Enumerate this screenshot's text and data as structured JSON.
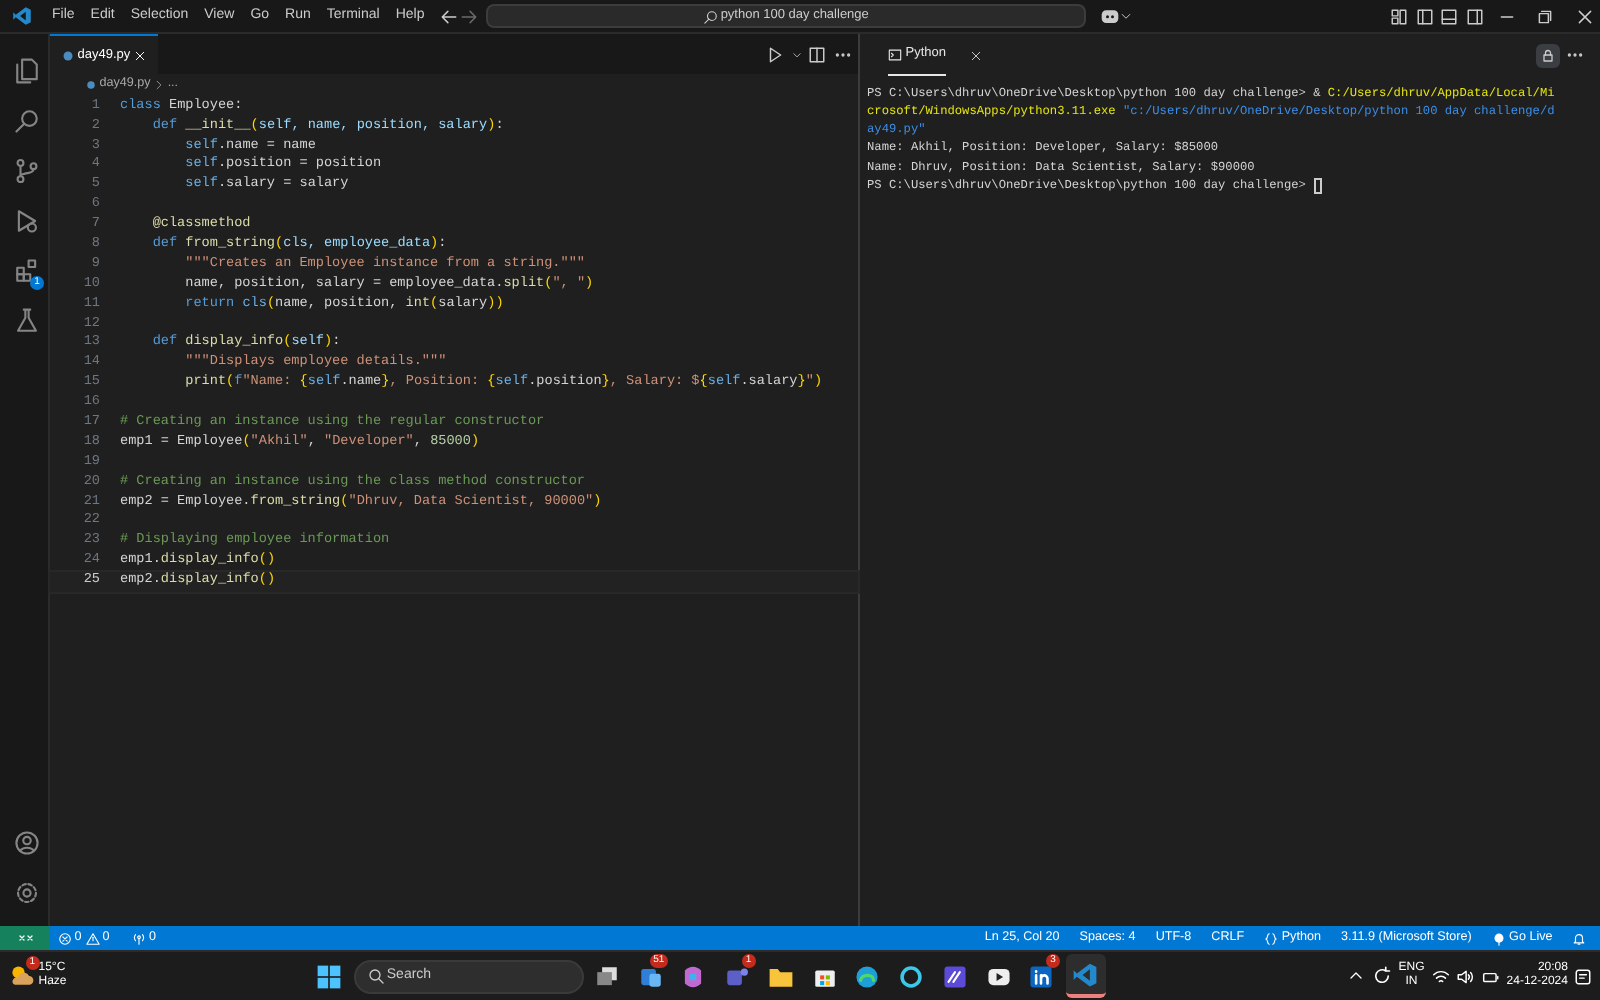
{
  "title_bar": {
    "menu": [
      "File",
      "Edit",
      "Selection",
      "View",
      "Go",
      "Run",
      "Terminal",
      "Help"
    ],
    "command_center": "python 100 day challenge"
  },
  "activity_bar": {
    "items": [
      {
        "kind": "explorer",
        "selected": false
      },
      {
        "kind": "search",
        "selected": false
      },
      {
        "kind": "source-control",
        "selected": false
      },
      {
        "kind": "run",
        "selected": false
      },
      {
        "kind": "extensions",
        "selected": false,
        "badge": "1"
      },
      {
        "kind": "testing",
        "selected": false
      }
    ],
    "bottom": [
      {
        "kind": "account"
      },
      {
        "kind": "settings"
      }
    ]
  },
  "editor": {
    "tabs": [
      {
        "label": "day49.py",
        "selected": true
      }
    ],
    "breadcrumb": [
      "day49.py",
      "..."
    ],
    "lines": [
      {
        "number": "1",
        "current": false,
        "tokens": [
          {
            "kind": "keyword",
            "text": "class"
          },
          {
            "kind": "plain",
            "text": " Employee:"
          }
        ]
      },
      {
        "number": "2",
        "current": false,
        "tokens": [
          {
            "kind": "keyword",
            "text": "    def"
          },
          {
            "kind": "function",
            "text": " __init__"
          },
          {
            "kind": "bracket",
            "text": "("
          },
          {
            "kind": "param",
            "text": "self, name, position, salary"
          },
          {
            "kind": "bracket",
            "text": ")"
          },
          {
            "kind": "plain",
            "text": ":"
          }
        ]
      },
      {
        "number": "3",
        "current": false,
        "tokens": [
          {
            "kind": "self",
            "text": "        self"
          },
          {
            "kind": "plain",
            "text": ".name = name"
          }
        ]
      },
      {
        "number": "4",
        "current": false,
        "tokens": [
          {
            "kind": "self",
            "text": "        self"
          },
          {
            "kind": "plain",
            "text": ".position = position"
          }
        ]
      },
      {
        "number": "5",
        "current": false,
        "tokens": [
          {
            "kind": "self",
            "text": "        self"
          },
          {
            "kind": "plain",
            "text": ".salary = salary"
          }
        ]
      },
      {
        "number": "6",
        "current": false
      },
      {
        "number": "7",
        "current": false,
        "tokens": [
          {
            "kind": "function",
            "text": "    @classmethod"
          }
        ]
      },
      {
        "number": "8",
        "current": false,
        "tokens": [
          {
            "kind": "keyword",
            "text": "    def"
          },
          {
            "kind": "function",
            "text": " from_string"
          },
          {
            "kind": "bracket",
            "text": "("
          },
          {
            "kind": "param",
            "text": "cls, employee_data"
          },
          {
            "kind": "bracket",
            "text": ")"
          },
          {
            "kind": "plain",
            "text": ":"
          }
        ]
      },
      {
        "number": "9",
        "current": false,
        "tokens": [
          {
            "kind": "string",
            "text": "        \"\"\"Creates an Employee instance from a string.\"\"\""
          }
        ]
      },
      {
        "number": "10",
        "current": false,
        "tokens": [
          {
            "kind": "plain",
            "text": "        name, position, salary = employee_data."
          },
          {
            "kind": "function",
            "text": "split"
          },
          {
            "kind": "bracket",
            "text": "("
          },
          {
            "kind": "string",
            "text": "\", \""
          },
          {
            "kind": "bracket",
            "text": ")"
          }
        ]
      },
      {
        "number": "11",
        "current": false,
        "tokens": [
          {
            "kind": "keyword",
            "text": "        return"
          },
          {
            "kind": "self",
            "text": " cls"
          },
          {
            "kind": "bracket",
            "text": "("
          },
          {
            "kind": "plain",
            "text": "name, position, "
          },
          {
            "kind": "function",
            "text": "int"
          },
          {
            "kind": "bracket",
            "text": "("
          },
          {
            "kind": "plain",
            "text": "salary"
          },
          {
            "kind": "bracket",
            "text": "))"
          }
        ]
      },
      {
        "number": "12",
        "current": false
      },
      {
        "number": "13",
        "current": false,
        "tokens": [
          {
            "kind": "keyword",
            "text": "    def"
          },
          {
            "kind": "function",
            "text": " display_info"
          },
          {
            "kind": "bracket",
            "text": "("
          },
          {
            "kind": "param",
            "text": "self"
          },
          {
            "kind": "bracket",
            "text": ")"
          },
          {
            "kind": "plain",
            "text": ":"
          }
        ]
      },
      {
        "number": "14",
        "current": false,
        "tokens": [
          {
            "kind": "string",
            "text": "        \"\"\"Displays employee details.\"\"\""
          }
        ]
      },
      {
        "number": "15",
        "current": false,
        "tokens": [
          {
            "kind": "function",
            "text": "        print"
          },
          {
            "kind": "bracket",
            "text": "("
          },
          {
            "kind": "keyword",
            "text": "f"
          },
          {
            "kind": "string",
            "text": "\"Name: "
          },
          {
            "kind": "bracket",
            "text": "{"
          },
          {
            "kind": "self",
            "text": "self"
          },
          {
            "kind": "plain",
            "text": ".name"
          },
          {
            "kind": "bracket",
            "text": "}"
          },
          {
            "kind": "string",
            "text": ", Position: "
          },
          {
            "kind": "bracket",
            "text": "{"
          },
          {
            "kind": "self",
            "text": "self"
          },
          {
            "kind": "plain",
            "text": ".position"
          },
          {
            "kind": "bracket",
            "text": "}"
          },
          {
            "kind": "string",
            "text": ", Salary: $"
          },
          {
            "kind": "bracket",
            "text": "{"
          },
          {
            "kind": "self",
            "text": "self"
          },
          {
            "kind": "plain",
            "text": ".salary"
          },
          {
            "kind": "bracket",
            "text": "}"
          },
          {
            "kind": "string",
            "text": "\""
          },
          {
            "kind": "bracket",
            "text": ")"
          }
        ]
      },
      {
        "number": "16",
        "current": false
      },
      {
        "number": "17",
        "current": false,
        "tokens": [
          {
            "kind": "comment",
            "text": "# Creating an instance using the regular constructor"
          }
        ]
      },
      {
        "number": "18",
        "current": false,
        "tokens": [
          {
            "kind": "plain",
            "text": "emp1 = Employee"
          },
          {
            "kind": "bracket",
            "text": "("
          },
          {
            "kind": "string",
            "text": "\"Akhil\""
          },
          {
            "kind": "plain",
            "text": ", "
          },
          {
            "kind": "string",
            "text": "\"Developer\""
          },
          {
            "kind": "plain",
            "text": ", "
          },
          {
            "kind": "number",
            "text": "85000"
          },
          {
            "kind": "bracket",
            "text": ")"
          }
        ]
      },
      {
        "number": "19",
        "current": false
      },
      {
        "number": "20",
        "current": false,
        "tokens": [
          {
            "kind": "comment",
            "text": "# Creating an instance using the class method constructor"
          }
        ]
      },
      {
        "number": "21",
        "current": false,
        "tokens": [
          {
            "kind": "plain",
            "text": "emp2 = Employee."
          },
          {
            "kind": "function",
            "text": "from_string"
          },
          {
            "kind": "bracket",
            "text": "("
          },
          {
            "kind": "string",
            "text": "\"Dhruv, Data Scientist, 90000\""
          },
          {
            "kind": "bracket",
            "text": ")"
          }
        ]
      },
      {
        "number": "22",
        "current": false
      },
      {
        "number": "23",
        "current": false,
        "tokens": [
          {
            "kind": "comment",
            "text": "# Displaying employee information"
          }
        ]
      },
      {
        "number": "24",
        "current": false,
        "tokens": [
          {
            "kind": "plain",
            "text": "emp1."
          },
          {
            "kind": "function",
            "text": "display_info"
          },
          {
            "kind": "bracket",
            "text": "()"
          }
        ]
      },
      {
        "number": "25",
        "current": true,
        "tokens": [
          {
            "kind": "plain",
            "text": "emp2."
          },
          {
            "kind": "function",
            "text": "display_info"
          },
          {
            "kind": "bracket",
            "text": "()"
          }
        ]
      }
    ]
  },
  "terminal": {
    "tabs": [
      {
        "label": "Python",
        "selected": true
      }
    ],
    "lines": [
      {
        "tokens": [
          {
            "kind": "plain",
            "text": "PS C:\\Users\\dhruv\\OneDrive\\Desktop\\python 100 day challenge> & "
          },
          {
            "kind": "path",
            "text": "C:/Users/dhruv/AppData/Local/Mi"
          }
        ]
      },
      {
        "tokens": [
          {
            "kind": "path",
            "text": "crosoft/WindowsApps/python3.11.exe"
          },
          {
            "kind": "string",
            "text": " \"c:/Users/dhruv/OneDrive/Desktop/python 100 day challenge/d"
          }
        ]
      },
      {
        "tokens": [
          {
            "kind": "string",
            "text": "ay49.py\""
          }
        ]
      },
      {
        "tokens": [
          {
            "kind": "plain",
            "text": "Name: Akhil, Position: Developer, Salary: $85000"
          }
        ]
      },
      {
        "tokens": [
          {
            "kind": "plain",
            "text": "Name: Dhruv, Position: Data Scientist, Salary: $90000"
          }
        ]
      },
      {
        "tokens": [
          {
            "kind": "plain",
            "text": "PS C:\\Users\\dhruv\\OneDrive\\Desktop\\python 100 day challenge> "
          }
        ],
        "cursor": true
      }
    ]
  },
  "status_bar": {
    "left": [
      {
        "kind": "errors",
        "text": "0"
      },
      {
        "kind": "warnings",
        "text": "0"
      },
      {
        "kind": "ports",
        "text": "0"
      }
    ],
    "right": [
      {
        "kind": "text",
        "text": "Ln 25, Col 20"
      },
      {
        "kind": "text",
        "text": "Spaces: 4"
      },
      {
        "kind": "text",
        "text": "UTF-8"
      },
      {
        "kind": "text",
        "text": "CRLF"
      },
      {
        "kind": "language",
        "text": "Python"
      },
      {
        "kind": "text",
        "text": "3.11.9 (Microsoft Store)"
      },
      {
        "kind": "live",
        "text": "Go Live"
      },
      {
        "kind": "notifications"
      }
    ]
  },
  "taskbar": {
    "weather": {
      "temperature": "15°C",
      "condition": "Haze",
      "badge": "1"
    },
    "search": "Search",
    "apps": [
      {
        "kind": "start",
        "active": false
      },
      {
        "kind": "taskview",
        "active": false
      },
      {
        "kind": "widgets",
        "active": false,
        "badge": "51"
      },
      {
        "kind": "copilot",
        "active": false
      },
      {
        "kind": "teams",
        "active": false,
        "badge": "1"
      },
      {
        "kind": "folder",
        "active": false
      },
      {
        "kind": "store",
        "active": false
      },
      {
        "kind": "edge",
        "active": false
      },
      {
        "kind": "ring",
        "active": false
      },
      {
        "kind": "tile",
        "active": false
      },
      {
        "kind": "play",
        "active": false
      },
      {
        "kind": "in",
        "active": false,
        "badge": "3"
      },
      {
        "kind": "code",
        "active": true
      }
    ],
    "tray": {
      "language": [
        "ENG",
        "IN"
      ],
      "time": "20:08",
      "date": "24-12-2024"
    }
  }
}
